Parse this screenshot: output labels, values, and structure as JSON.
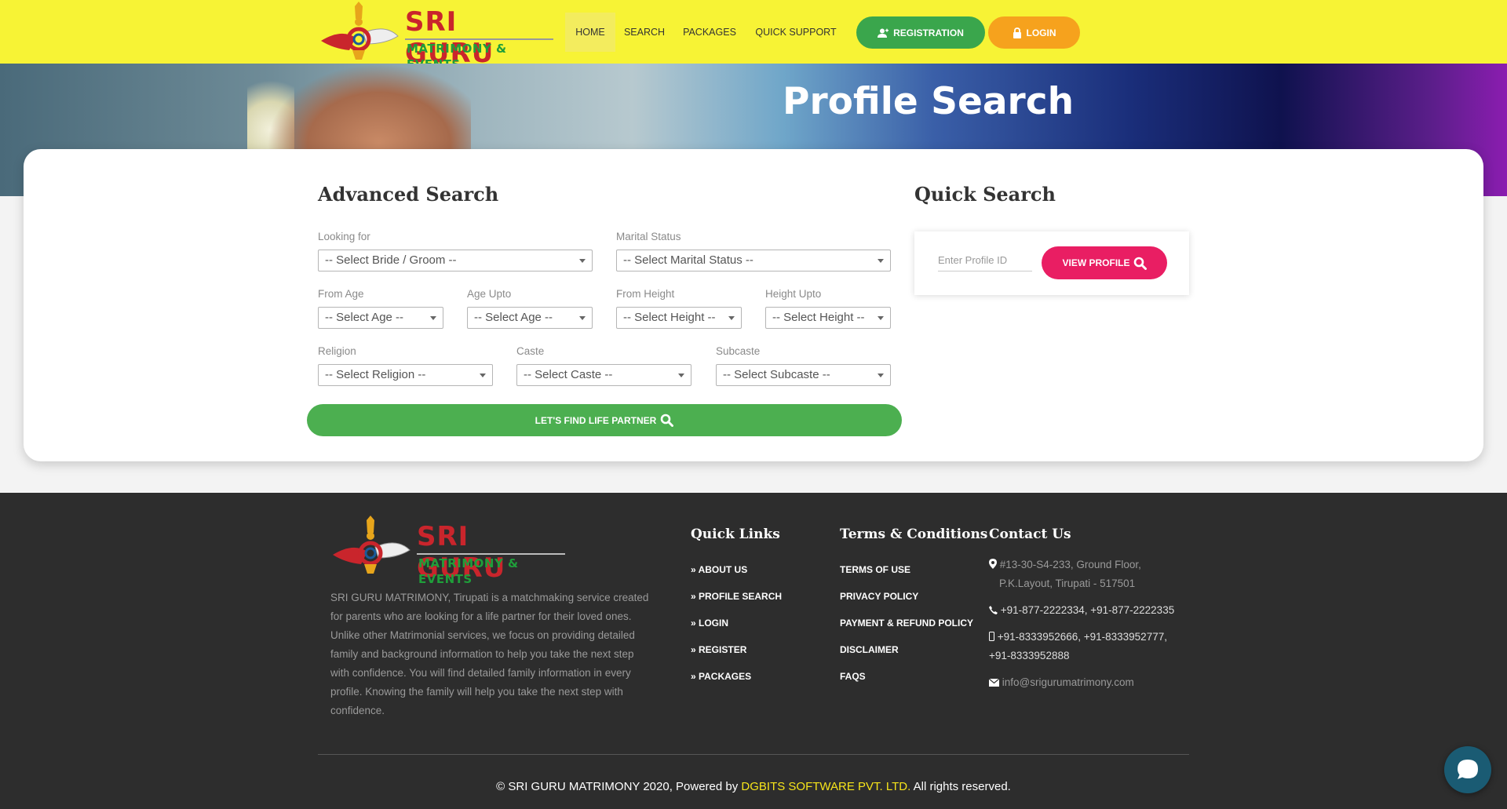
{
  "brand": {
    "name": "SRI GURU",
    "tagline": "MATRIMONY & EVENTS",
    "colors": {
      "primary_red": "#c9252c",
      "green": "#1f9e3a",
      "header_yellow": "#f7f335"
    }
  },
  "nav": {
    "items": [
      {
        "label": "HOME"
      },
      {
        "label": "SEARCH"
      },
      {
        "label": "PACKAGES"
      },
      {
        "label": "QUICK SUPPORT"
      }
    ],
    "registration_label": "REGISTRATION",
    "login_label": "LOGIN",
    "registration_color": "#3aa64c",
    "login_color": "#f6a21d"
  },
  "banner": {
    "title": "Profile Search"
  },
  "advanced_search": {
    "title": "Advanced Search",
    "fields": {
      "looking_for": {
        "label": "Looking for",
        "value": "-- Select Bride / Groom --"
      },
      "marital_status": {
        "label": "Marital Status",
        "value": "-- Select Marital Status --"
      },
      "from_age": {
        "label": "From Age",
        "value": "-- Select Age --"
      },
      "age_upto": {
        "label": "Age Upto",
        "value": "-- Select Age --"
      },
      "from_height": {
        "label": "From Height",
        "value": "-- Select Height --"
      },
      "height_upto": {
        "label": "Height Upto",
        "value": "-- Select Height --"
      },
      "religion": {
        "label": "Religion",
        "value": "-- Select Religion --"
      },
      "caste": {
        "label": "Caste",
        "value": "-- Select Caste --"
      },
      "subcaste": {
        "label": "Subcaste",
        "value": "-- Select Subcaste --"
      }
    },
    "submit_label": "LET'S FIND LIFE PARTNER",
    "submit_color": "#4caf50"
  },
  "quick_search": {
    "title": "Quick Search",
    "placeholder": "Enter Profile ID",
    "button_label": "VIEW PROFILE",
    "button_color": "#e91e63"
  },
  "footer": {
    "about": "SRI GURU MATRIMONY, Tirupati is a matchmaking service created for parents who are looking for a life partner for their loved ones. Unlike other Matrimonial services, we focus on providing detailed family and background information to help you take the next step with confidence. You will find detailed family information in every profile. Knowing the family will help you take the next step with confidence.",
    "quick_links": {
      "title": "Quick Links",
      "items": [
        "ABOUT US",
        "PROFILE SEARCH",
        "LOGIN",
        "REGISTER",
        "PACKAGES"
      ]
    },
    "terms": {
      "title": "Terms & Conditions",
      "items": [
        "TERMS OF USE",
        "PRIVACY POLICY",
        "PAYMENT & REFUND POLICY",
        "DISCLAIMER",
        "FAQS"
      ]
    },
    "contact": {
      "title": "Contact Us",
      "address_line1": "#13-30-S4-233, Ground Floor,",
      "address_line2": "P.K.Layout, Tirupati - 517501",
      "phones": "+91-877-2222334, +91-877-2222335",
      "mobiles_line1": "+91-8333952666, +91-8333952777,",
      "mobiles_line2": "+91-8333952888",
      "email": "info@srigurumatrimony.com"
    },
    "copyright_prefix": "© SRI GURU MATRIMONY 2020, Powered by ",
    "copyright_link": "DGBITS SOFTWARE PVT. LTD.",
    "copyright_suffix": " All rights reserved."
  }
}
